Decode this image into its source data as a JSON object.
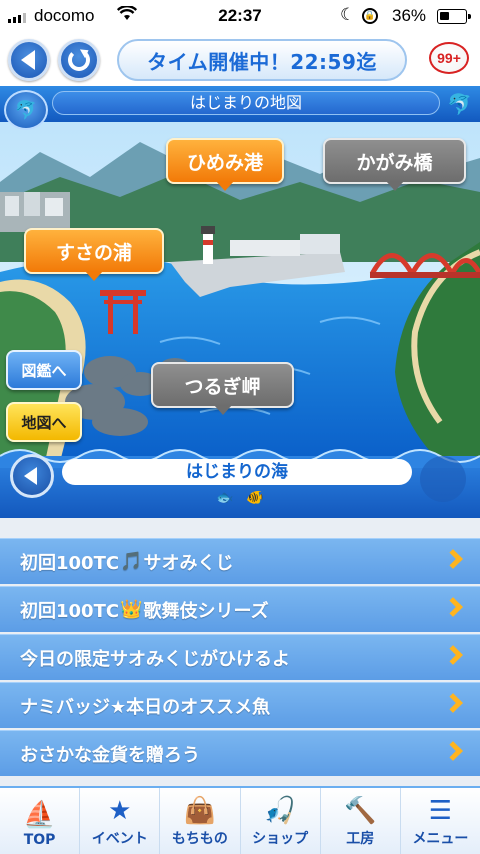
{
  "status_bar": {
    "carrier": "docomo",
    "time": "22:37",
    "battery": "36%",
    "battery_level": 0.36
  },
  "header": {
    "event_text": "タイム開催中！22:59迄",
    "notification_badge": "99+"
  },
  "map": {
    "title": "はじまりの地図",
    "locations": [
      {
        "name": "ひめみ港",
        "style": "orange"
      },
      {
        "name": "かがみ橋",
        "style": "gray"
      },
      {
        "name": "すさの浦",
        "style": "orange"
      },
      {
        "name": "つるぎ岬",
        "style": "gray"
      }
    ],
    "side_buttons": {
      "encyclopedia": "図鑑へ",
      "map": "地図へ"
    },
    "area_name": "はじまりの海",
    "page_indicator": {
      "current": 2,
      "total": 2
    }
  },
  "menu": {
    "items": [
      {
        "prefix": "初回100TC",
        "icon": "music-note-icon",
        "glyph": "🎵",
        "suffix": "サオみくじ"
      },
      {
        "prefix": "初回100TC",
        "icon": "crown-icon",
        "glyph": "👑",
        "suffix": "歌舞伎シリーズ"
      },
      {
        "prefix": "今日の限定サオみくじがひけるよ",
        "icon": "",
        "glyph": "",
        "suffix": ""
      },
      {
        "prefix": "ナミバッジ★本日のオススメ魚",
        "icon": "",
        "glyph": "",
        "suffix": ""
      },
      {
        "prefix": "おさかな金貨を贈ろう",
        "icon": "",
        "glyph": "",
        "suffix": ""
      }
    ]
  },
  "bottom_nav": {
    "items": [
      {
        "label": "TOP",
        "icon": "boat-icon",
        "glyph": "⛵"
      },
      {
        "label": "イベント",
        "icon": "star-icon",
        "glyph": "★"
      },
      {
        "label": "もちもの",
        "icon": "bag-icon",
        "glyph": "👜"
      },
      {
        "label": "ショップ",
        "icon": "fishing-rod-icon",
        "glyph": "🎣"
      },
      {
        "label": "工房",
        "icon": "hammer-icon",
        "glyph": "🔨"
      },
      {
        "label": "メニュー",
        "icon": "hamburger-icon",
        "glyph": "☰"
      }
    ]
  },
  "colors": {
    "primary_blue": "#1b6ad6",
    "orange_tag": "#f27a08",
    "gray_tag": "#6d6d6d",
    "menu_bg": "#6aa9ea",
    "chevron": "#ffb41f"
  }
}
